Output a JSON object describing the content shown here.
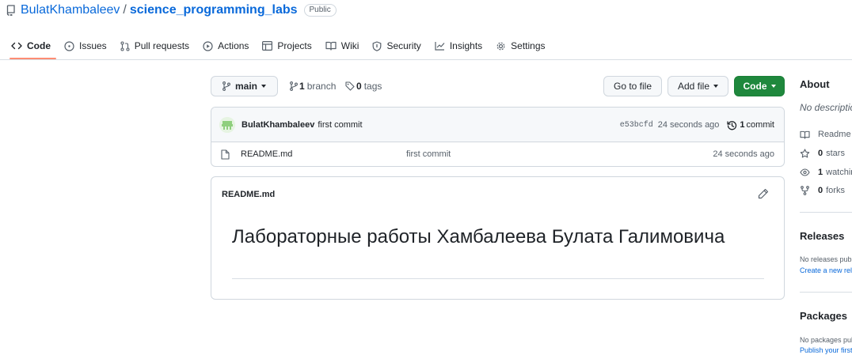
{
  "repo": {
    "owner": "BulatKhambaleev",
    "separator": "/",
    "name": "science_programming_labs",
    "visibility": "Public"
  },
  "tabs": [
    {
      "label": "Code",
      "icon": "code-icon",
      "active": true
    },
    {
      "label": "Issues",
      "icon": "issue-opened-icon"
    },
    {
      "label": "Pull requests",
      "icon": "git-pull-request-icon"
    },
    {
      "label": "Actions",
      "icon": "play-icon"
    },
    {
      "label": "Projects",
      "icon": "table-icon"
    },
    {
      "label": "Wiki",
      "icon": "book-icon"
    },
    {
      "label": "Security",
      "icon": "shield-icon"
    },
    {
      "label": "Insights",
      "icon": "graph-icon"
    },
    {
      "label": "Settings",
      "icon": "gear-icon"
    }
  ],
  "toolbar": {
    "branch_selector": "main",
    "branch_count": "1",
    "branch_label": "branch",
    "tag_count": "0",
    "tag_label": "tags",
    "go_to_file": "Go to file",
    "add_file": "Add file",
    "code": "Code"
  },
  "latest_commit": {
    "author": "BulatKhambaleev",
    "message": "first commit",
    "sha": "e53bcfd",
    "age": "24 seconds ago",
    "commit_count": "1",
    "commit_label": "commit"
  },
  "files": [
    {
      "name": "README.md",
      "commit_message": "first commit",
      "age": "24 seconds ago"
    }
  ],
  "readme": {
    "filename": "README.md",
    "heading": "Лабораторные работы Хамбалеева Булата Галимовича"
  },
  "sidebar": {
    "about_title": "About",
    "description": "No description",
    "readme_label": "Readme",
    "stars_count": "0",
    "stars_label": "stars",
    "watching_count": "1",
    "watching_label": "watching",
    "forks_count": "0",
    "forks_label": "forks",
    "releases_title": "Releases",
    "releases_text": "No releases published",
    "releases_link": "Create a new release",
    "packages_title": "Packages",
    "packages_text": "No packages published",
    "packages_link": "Publish your first package"
  },
  "colors": {
    "link": "#0969da",
    "primary_button": "#1f883d",
    "active_tab_underline": "#fd8c73"
  }
}
